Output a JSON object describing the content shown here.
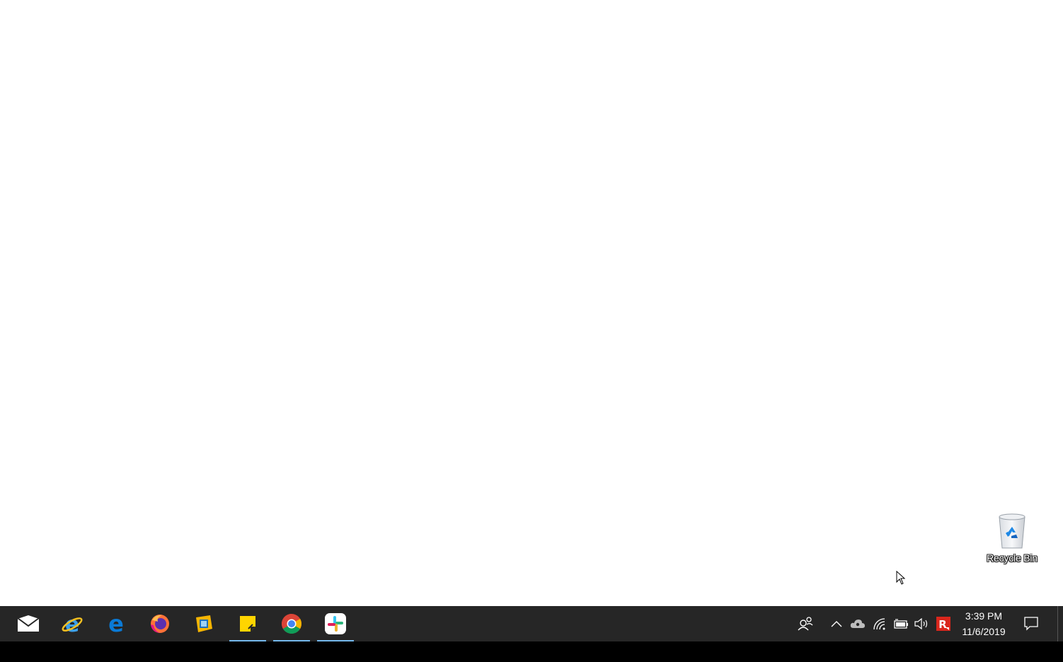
{
  "desktop": {
    "recycle_bin_label": "Recycle Bin"
  },
  "taskbar": {
    "pinned": [
      {
        "name": "mail-icon",
        "running": false
      },
      {
        "name": "internet-explorer-icon",
        "running": false
      },
      {
        "name": "edge-icon",
        "running": false
      },
      {
        "name": "firefox-icon",
        "running": false
      },
      {
        "name": "virtualbox-icon",
        "running": false
      },
      {
        "name": "sticky-notes-icon",
        "running": true
      },
      {
        "name": "chrome-icon",
        "running": true
      },
      {
        "name": "slack-icon",
        "running": true
      }
    ],
    "tray": [
      "people-icon",
      "chevron-up-icon",
      "cloud-icon",
      "wifi-icon",
      "battery-icon",
      "volume-icon",
      "app-r-icon"
    ],
    "clock": {
      "time": "3:39 PM",
      "date": "11/6/2019"
    },
    "accent_color": "#76b9ed",
    "background_color": "#262626"
  }
}
